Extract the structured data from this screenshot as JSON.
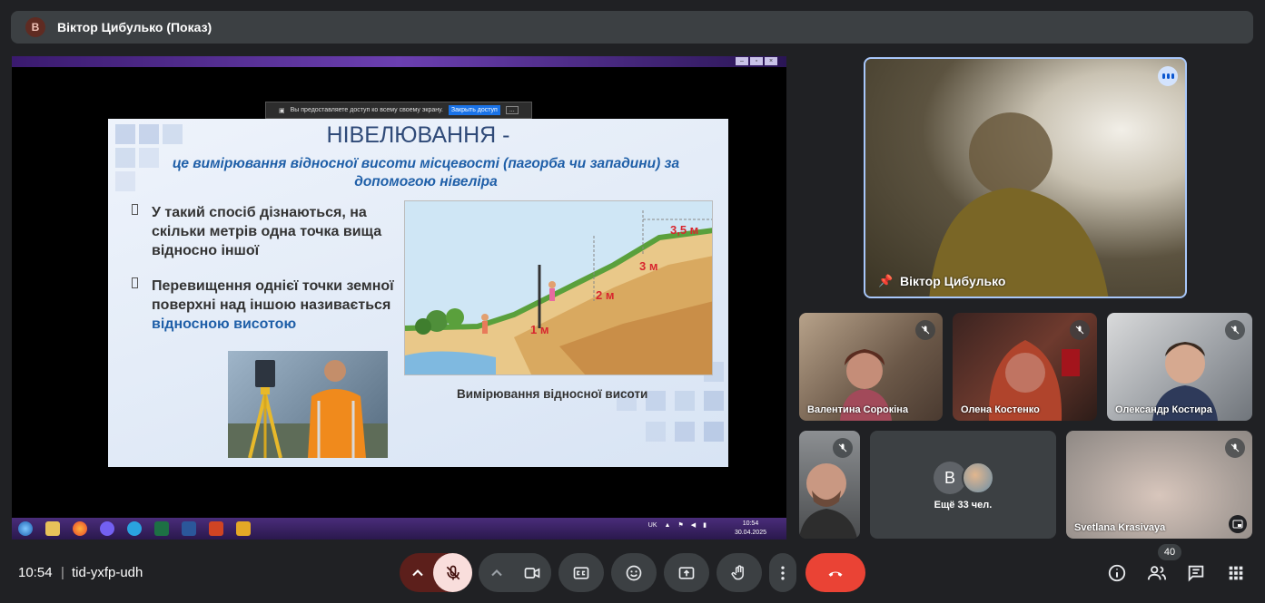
{
  "presenter_bar": {
    "avatar_letter": "В",
    "title": "Віктор Цибулько (Показ)"
  },
  "share_notice": {
    "text": "Вы предоставляете доступ ко всему своему экрану.",
    "stop_label": "Закрыть доступ",
    "more": "..."
  },
  "slide": {
    "title": "НІВЕЛЮВАННЯ -",
    "subtitle": "це вимірювання відносної висоти місцевості (пагорба чи западини) за допомогою нівеліра",
    "bullet1": "У такий спосіб дізнаються, на скільки метрів одна точка вища відносно іншої",
    "bullet2_a": "Перевищення однієї точки земної поверхні над іншою називається",
    "bullet2_b": "відносною висотою",
    "heights": [
      "1 м",
      "2 м",
      "3 м",
      "3,5 м"
    ],
    "caption": "Вимірювання відносної висоти"
  },
  "taskbar": {
    "lang": "UK",
    "clock_time": "10:54",
    "clock_date": "30.04.2025"
  },
  "participants": {
    "main": {
      "name": "Віктор Цибулько"
    },
    "p1": {
      "name": "Валентина Сорокіна"
    },
    "p2": {
      "name": "Олена Костенко"
    },
    "p3": {
      "name": "Олександр Костира"
    },
    "p5": {
      "letter": "В",
      "more": "Ещё 33 чел."
    },
    "p6": {
      "name": "Svetlana Krasivaya"
    }
  },
  "bottom": {
    "time": "10:54",
    "separator": "|",
    "meeting_code": "tid-yxfp-udh",
    "people_count": "40"
  },
  "colors": {
    "accent": "#a8c7fa",
    "end_call": "#ea4335",
    "mic_off_bg": "#f9dedc"
  }
}
